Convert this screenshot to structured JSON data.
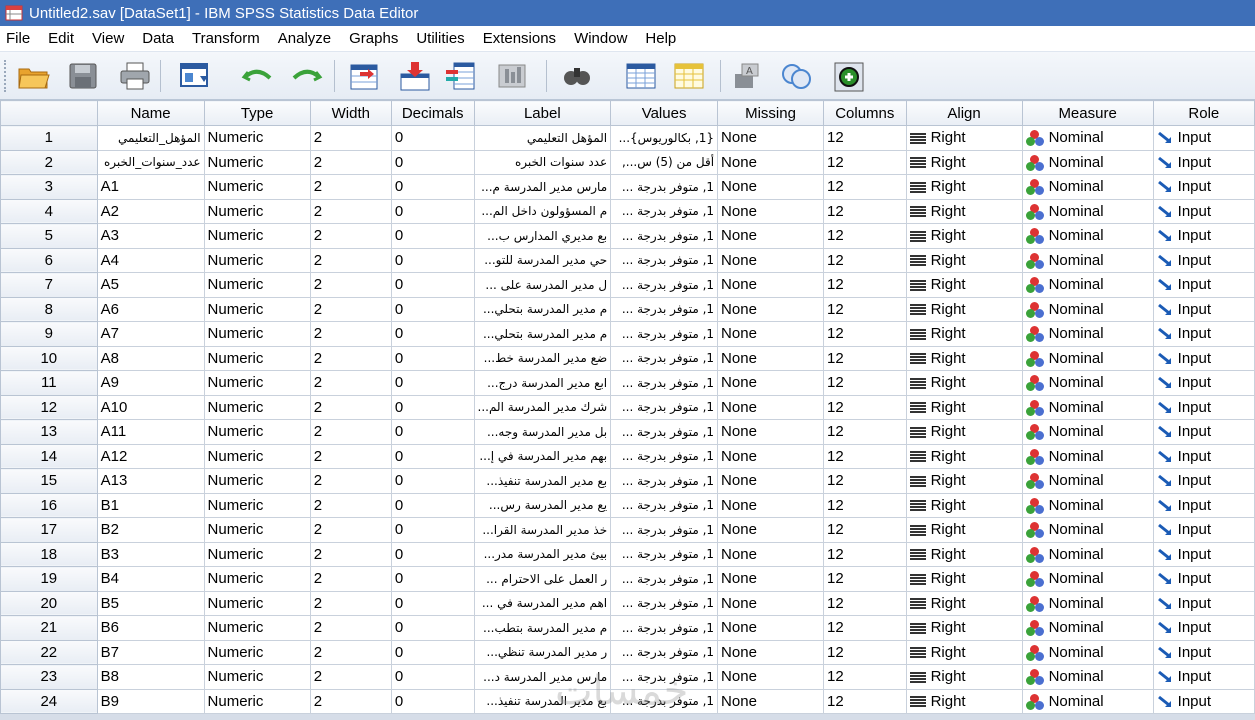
{
  "window": {
    "title": "Untitled2.sav [DataSet1] - IBM SPSS Statistics Data Editor"
  },
  "menu": [
    {
      "label": "File",
      "ul": "F",
      "rest": "ile"
    },
    {
      "label": "Edit",
      "ul": "E",
      "rest": "dit"
    },
    {
      "label": "View",
      "ul": "V",
      "rest": "iew"
    },
    {
      "label": "Data",
      "ul": "D",
      "rest": "ata"
    },
    {
      "label": "Transform",
      "ul": "T",
      "rest": "ransform"
    },
    {
      "label": "Analyze",
      "ul": "A",
      "rest": "nalyze"
    },
    {
      "label": "Graphs",
      "ul": "G",
      "rest": "raphs"
    },
    {
      "label": "Utilities",
      "ul": "U",
      "rest": "tilities"
    },
    {
      "label": "Extensions",
      "ul": "x",
      "pre": "E",
      "rest": "tensions"
    },
    {
      "label": "Window",
      "ul": "W",
      "rest": "indow"
    },
    {
      "label": "Help",
      "ul": "H",
      "rest": "elp"
    }
  ],
  "toolbar": [
    {
      "name": "open-icon"
    },
    {
      "name": "save-icon"
    },
    {
      "name": "print-icon"
    },
    {
      "name": "dialog-recall-icon"
    },
    {
      "name": "undo-icon"
    },
    {
      "name": "redo-icon"
    },
    {
      "name": "goto-case-icon"
    },
    {
      "name": "goto-variable-icon"
    },
    {
      "name": "variables-icon"
    },
    {
      "name": "run-descriptives-icon"
    },
    {
      "name": "find-icon"
    },
    {
      "name": "insert-cases-icon"
    },
    {
      "name": "insert-variable-icon"
    },
    {
      "name": "split-file-icon"
    },
    {
      "name": "value-labels-icon"
    },
    {
      "name": "use-variable-sets-icon"
    },
    {
      "name": "customize-icon"
    }
  ],
  "columns": [
    "Name",
    "Type",
    "Width",
    "Decimals",
    "Label",
    "Values",
    "Missing",
    "Columns",
    "Align",
    "Measure",
    "Role"
  ],
  "rows": [
    {
      "n": "1",
      "name": "المؤهل_التعليمي",
      "type": "Numeric",
      "width": "2",
      "dec": "0",
      "label": "المؤهل التعليمي",
      "values": "{1, بكالوريوس}...",
      "missing": "None",
      "cols": "12",
      "align": "Right",
      "measure": "Nominal",
      "role": "Input"
    },
    {
      "n": "2",
      "name": "عدد_سنوات_الخبره",
      "type": "Numeric",
      "width": "2",
      "dec": "0",
      "label": "عدد سنوات الخبره",
      "values": "أقل من (5) س...,",
      "missing": "None",
      "cols": "12",
      "align": "Right",
      "measure": "Nominal",
      "role": "Input"
    },
    {
      "n": "3",
      "name": "A1",
      "type": "Numeric",
      "width": "2",
      "dec": "0",
      "label": "مارس مدير المدرسة م...",
      "values": "1, متوفر بدرجة ...",
      "missing": "None",
      "cols": "12",
      "align": "Right",
      "measure": "Nominal",
      "role": "Input"
    },
    {
      "n": "4",
      "name": "A2",
      "type": "Numeric",
      "width": "2",
      "dec": "0",
      "label": "م المسؤولون داخل الم...",
      "values": "1, متوفر بدرجة ...",
      "missing": "None",
      "cols": "12",
      "align": "Right",
      "measure": "Nominal",
      "role": "Input"
    },
    {
      "n": "5",
      "name": "A3",
      "type": "Numeric",
      "width": "2",
      "dec": "0",
      "label": "بع مديري المدارس ب...",
      "values": "1, متوفر بدرجة ...",
      "missing": "None",
      "cols": "12",
      "align": "Right",
      "measure": "Nominal",
      "role": "Input"
    },
    {
      "n": "6",
      "name": "A4",
      "type": "Numeric",
      "width": "2",
      "dec": "0",
      "label": "حي مدير المدرسة للتو...",
      "values": "1, متوفر بدرجة ...",
      "missing": "None",
      "cols": "12",
      "align": "Right",
      "measure": "Nominal",
      "role": "Input"
    },
    {
      "n": "7",
      "name": "A5",
      "type": "Numeric",
      "width": "2",
      "dec": "0",
      "label": "ل مدير المدرسة على ...",
      "values": "1, متوفر بدرجة ...",
      "missing": "None",
      "cols": "12",
      "align": "Right",
      "measure": "Nominal",
      "role": "Input"
    },
    {
      "n": "8",
      "name": "A6",
      "type": "Numeric",
      "width": "2",
      "dec": "0",
      "label": "م مدير المدرسة بتحلي...",
      "values": "1, متوفر بدرجة ...",
      "missing": "None",
      "cols": "12",
      "align": "Right",
      "measure": "Nominal",
      "role": "Input"
    },
    {
      "n": "9",
      "name": "A7",
      "type": "Numeric",
      "width": "2",
      "dec": "0",
      "label": "م مدير المدرسة بتحلي...",
      "values": "1, متوفر بدرجة ...",
      "missing": "None",
      "cols": "12",
      "align": "Right",
      "measure": "Nominal",
      "role": "Input"
    },
    {
      "n": "10",
      "name": "A8",
      "type": "Numeric",
      "width": "2",
      "dec": "0",
      "label": "ضع مدير المدرسة خط...",
      "values": "1, متوفر بدرجة ...",
      "missing": "None",
      "cols": "12",
      "align": "Right",
      "measure": "Nominal",
      "role": "Input"
    },
    {
      "n": "11",
      "name": "A9",
      "type": "Numeric",
      "width": "2",
      "dec": "0",
      "label": "ابع مدير المدرسة درج...",
      "values": "1, متوفر بدرجة ...",
      "missing": "None",
      "cols": "12",
      "align": "Right",
      "measure": "Nominal",
      "role": "Input"
    },
    {
      "n": "12",
      "name": "A10",
      "type": "Numeric",
      "width": "2",
      "dec": "0",
      "label": "شرك مدير المدرسة الم...",
      "values": "1, متوفر بدرجة ...",
      "missing": "None",
      "cols": "12",
      "align": "Right",
      "measure": "Nominal",
      "role": "Input"
    },
    {
      "n": "13",
      "name": "A11",
      "type": "Numeric",
      "width": "2",
      "dec": "0",
      "label": "بل مدير المدرسة وجه...",
      "values": "1, متوفر بدرجة ...",
      "missing": "None",
      "cols": "12",
      "align": "Right",
      "measure": "Nominal",
      "role": "Input"
    },
    {
      "n": "14",
      "name": "A12",
      "type": "Numeric",
      "width": "2",
      "dec": "0",
      "label": "بهم مدير المدرسة في إ...",
      "values": "1, متوفر بدرجة ...",
      "missing": "None",
      "cols": "12",
      "align": "Right",
      "measure": "Nominal",
      "role": "Input"
    },
    {
      "n": "15",
      "name": "A13",
      "type": "Numeric",
      "width": "2",
      "dec": "0",
      "label": "بع مدير المدرسة تنفيذ...",
      "values": "1, متوفر بدرجة ...",
      "missing": "None",
      "cols": "12",
      "align": "Right",
      "measure": "Nominal",
      "role": "Input"
    },
    {
      "n": "16",
      "name": "B1",
      "type": "Numeric",
      "width": "2",
      "dec": "0",
      "label": "يع مدير المدرسة رس...",
      "values": "1, متوفر بدرجة ...",
      "missing": "None",
      "cols": "12",
      "align": "Right",
      "measure": "Nominal",
      "role": "Input"
    },
    {
      "n": "17",
      "name": "B2",
      "type": "Numeric",
      "width": "2",
      "dec": "0",
      "label": "خذ مدير المدرسة القرا...",
      "values": "1, متوفر بدرجة ...",
      "missing": "None",
      "cols": "12",
      "align": "Right",
      "measure": "Nominal",
      "role": "Input"
    },
    {
      "n": "18",
      "name": "B3",
      "type": "Numeric",
      "width": "2",
      "dec": "0",
      "label": "بيئ مدير المدرسة مدر...",
      "values": "1, متوفر بدرجة ...",
      "missing": "None",
      "cols": "12",
      "align": "Right",
      "measure": "Nominal",
      "role": "Input"
    },
    {
      "n": "19",
      "name": "B4",
      "type": "Numeric",
      "width": "2",
      "dec": "0",
      "label": "ر العمل على الاحترام ...",
      "values": "1, متوفر بدرجة ...",
      "missing": "None",
      "cols": "12",
      "align": "Right",
      "measure": "Nominal",
      "role": "Input"
    },
    {
      "n": "20",
      "name": "B5",
      "type": "Numeric",
      "width": "2",
      "dec": "0",
      "label": "اهم مدير المدرسة في ...",
      "values": "1, متوفر بدرجة ...",
      "missing": "None",
      "cols": "12",
      "align": "Right",
      "measure": "Nominal",
      "role": "Input"
    },
    {
      "n": "21",
      "name": "B6",
      "type": "Numeric",
      "width": "2",
      "dec": "0",
      "label": "م مدير المدرسة بتطب...",
      "values": "1, متوفر بدرجة ...",
      "missing": "None",
      "cols": "12",
      "align": "Right",
      "measure": "Nominal",
      "role": "Input"
    },
    {
      "n": "22",
      "name": "B7",
      "type": "Numeric",
      "width": "2",
      "dec": "0",
      "label": "ر مدير المدرسة تنظي...",
      "values": "1, متوفر بدرجة ...",
      "missing": "None",
      "cols": "12",
      "align": "Right",
      "measure": "Nominal",
      "role": "Input"
    },
    {
      "n": "23",
      "name": "B8",
      "type": "Numeric",
      "width": "2",
      "dec": "0",
      "label": "مارس مدير المدرسة د...",
      "values": "1, متوفر بدرجة ...",
      "missing": "None",
      "cols": "12",
      "align": "Right",
      "measure": "Nominal",
      "role": "Input"
    },
    {
      "n": "24",
      "name": "B9",
      "type": "Numeric",
      "width": "2",
      "dec": "0",
      "label": "بع مدير المدرسة تنفيذ...",
      "values": "1, متوفر بدرجة ...",
      "missing": "None",
      "cols": "12",
      "align": "Right",
      "measure": "Nominal",
      "role": "Input"
    }
  ],
  "colors": {
    "titlebar": "#3e6fb8",
    "grid_bg": "#d6dde8"
  }
}
